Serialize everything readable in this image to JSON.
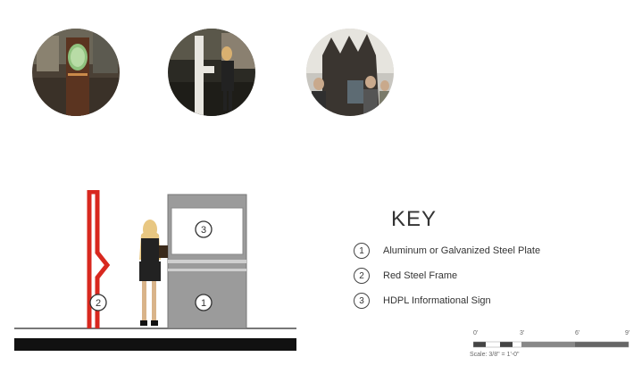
{
  "photos": [
    {
      "name": "round sculptural sign photo"
    },
    {
      "name": "kiosk with visitor photo"
    },
    {
      "name": "steel frame sign with visitors photo"
    }
  ],
  "elevation": {
    "callout_1": "1",
    "callout_2": "2",
    "callout_3": "3"
  },
  "key": {
    "title": "KEY",
    "items": [
      {
        "number": "1",
        "label": "Aluminum or Galvanized Steel Plate"
      },
      {
        "number": "2",
        "label": "Red Steel Frame"
      },
      {
        "number": "3",
        "label": "HDPL Informational Sign"
      }
    ]
  },
  "scale": {
    "ticks": [
      "0'",
      "3'",
      "6'",
      "9'"
    ],
    "note": "Scale: 3/8\" = 1'-0\""
  },
  "colors": {
    "frame_red": "#d8281f",
    "panel_gray": "#9b9b9b",
    "ground_black": "#111111"
  }
}
